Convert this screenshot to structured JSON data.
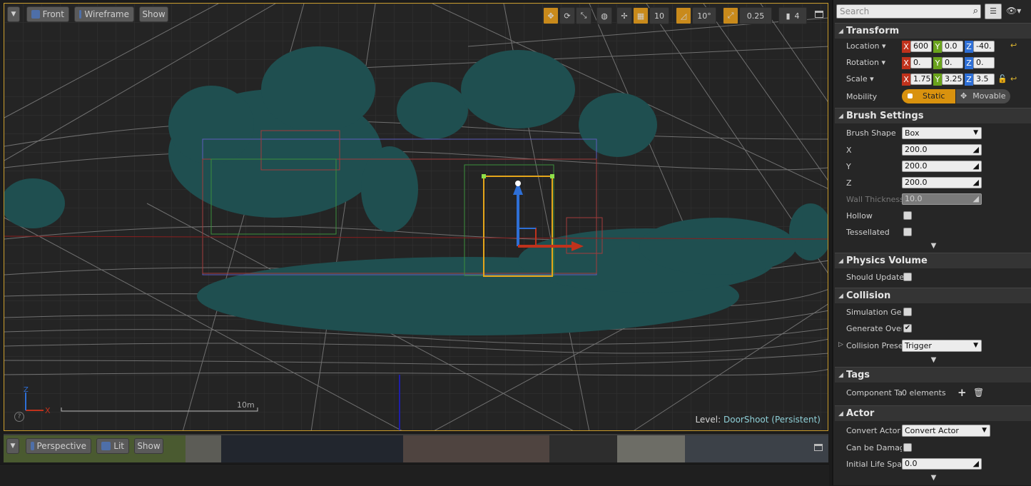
{
  "viewport_top": {
    "view_mode": "Front",
    "render_mode": "Wireframe",
    "show_label": "Show",
    "grid_snap": "10",
    "rotation_snap": "10°",
    "scale_snap": "0.25",
    "camera_speed": "4",
    "scale_bar_label": "10m",
    "level_prefix": "Level:",
    "level_name": "DoorShoot (Persistent)"
  },
  "viewport_bottom": {
    "view_mode": "Perspective",
    "render_mode": "Lit",
    "show_label": "Show"
  },
  "details": {
    "search_placeholder": "Search",
    "transform": {
      "title": "Transform",
      "location_label": "Location",
      "rotation_label": "Rotation",
      "scale_label": "Scale",
      "mobility_label": "Mobility",
      "location": {
        "x": "600",
        "y": "0.0",
        "z": "-40."
      },
      "rotation": {
        "x": "0.",
        "y": "0.",
        "z": "0."
      },
      "scale": {
        "x": "1.75",
        "y": "3.25",
        "z": "3.5"
      },
      "mobility_static": "Static",
      "mobility_movable": "Movable"
    },
    "brush": {
      "title": "Brush Settings",
      "shape_label": "Brush Shape",
      "shape_value": "Box",
      "x_label": "X",
      "x_value": "200.0",
      "y_label": "Y",
      "y_value": "200.0",
      "z_label": "Z",
      "z_value": "200.0",
      "wall_label": "Wall Thickness",
      "wall_value": "10.0",
      "hollow_label": "Hollow",
      "tess_label": "Tessellated"
    },
    "physics": {
      "title": "Physics Volume",
      "should_update_label": "Should Update"
    },
    "collision": {
      "title": "Collision",
      "sim_label": "Simulation Gen",
      "gen_label": "Generate Overl",
      "preset_label": "Collision Prese",
      "preset_value": "Trigger"
    },
    "tags": {
      "title": "Tags",
      "component_label": "Component Ta",
      "component_value": "0 elements"
    },
    "actor": {
      "title": "Actor",
      "convert_label": "Convert Actor",
      "convert_value": "Convert Actor",
      "damage_label": "Can be Damag",
      "lifespan_label": "Initial Life Spa",
      "lifespan_value": "0.0"
    }
  },
  "colors": {
    "foliage": "#1f4f50",
    "accent_orange": "#c98a1b",
    "axis_x": "#c0321c",
    "axis_y": "#6aa31c",
    "axis_z": "#2e6fd6",
    "selection_border": "#c89a2a"
  }
}
